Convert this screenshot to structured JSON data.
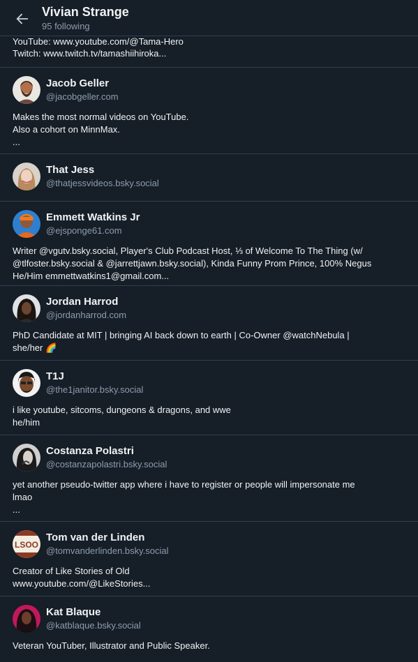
{
  "header": {
    "title": "Vivian Strange",
    "subtitle": "95 following",
    "back_icon": "arrow-left-icon"
  },
  "partial": {
    "lines": [
      "YouTube: www.youtube.com/@Tama-Hero",
      "Twitch: www.twitch.tv/tamashiihiroka..."
    ]
  },
  "colors": {
    "background": "#161e27",
    "divider": "#2e4052",
    "text": "#f1f3f5",
    "muted": "#8d9db0"
  },
  "accounts": [
    {
      "name": "Jacob Geller",
      "handle": "@jacobgeller.com",
      "bio": [
        "Makes the most normal videos on YouTube.",
        "Also a cohort on MinnMax.",
        "..."
      ]
    },
    {
      "name": "That Jess",
      "handle": "@thatjessvideos.bsky.social",
      "bio": []
    },
    {
      "name": "Emmett Watkins Jr",
      "handle": "@ejsponge61.com",
      "bio": [
        "Writer @vgutv.bsky.social, Player's Club Podcast Host, ⅓ of Welcome To The Thing (w/",
        "@tlfoster.bsky.social & @jarrettjawn.bsky.social), Kinda Funny Prom Prince, 100% Negus",
        "He/Him  emmettwatkins1@gmail.com..."
      ]
    },
    {
      "name": "Jordan Harrod",
      "handle": "@jordanharrod.com",
      "bio": [
        "PhD Candidate at MIT | bringing AI back down to earth | Co-Owner @watchNebula |",
        "she/her 🌈"
      ]
    },
    {
      "name": "T1J",
      "handle": "@the1janitor.bsky.social",
      "bio": [
        "i like youtube, sitcoms, dungeons & dragons, and wwe",
        "he/him"
      ]
    },
    {
      "name": "Costanza Polastri",
      "handle": "@costanzapolastri.bsky.social",
      "bio": [
        "yet another pseudo-twitter app where i have to register or people will impersonate me",
        "lmao",
        "..."
      ]
    },
    {
      "name": "Tom van der Linden",
      "handle": "@tomvanderlinden.bsky.social",
      "bio": [
        "Creator of Like Stories of Old",
        "www.youtube.com/@LikeStories..."
      ],
      "avatar_text": "LSOO"
    },
    {
      "name": "Kat Blaque",
      "handle": "@katblaque.bsky.social",
      "bio": [
        "Veteran YouTuber, Illustrator and Public Speaker."
      ]
    }
  ]
}
